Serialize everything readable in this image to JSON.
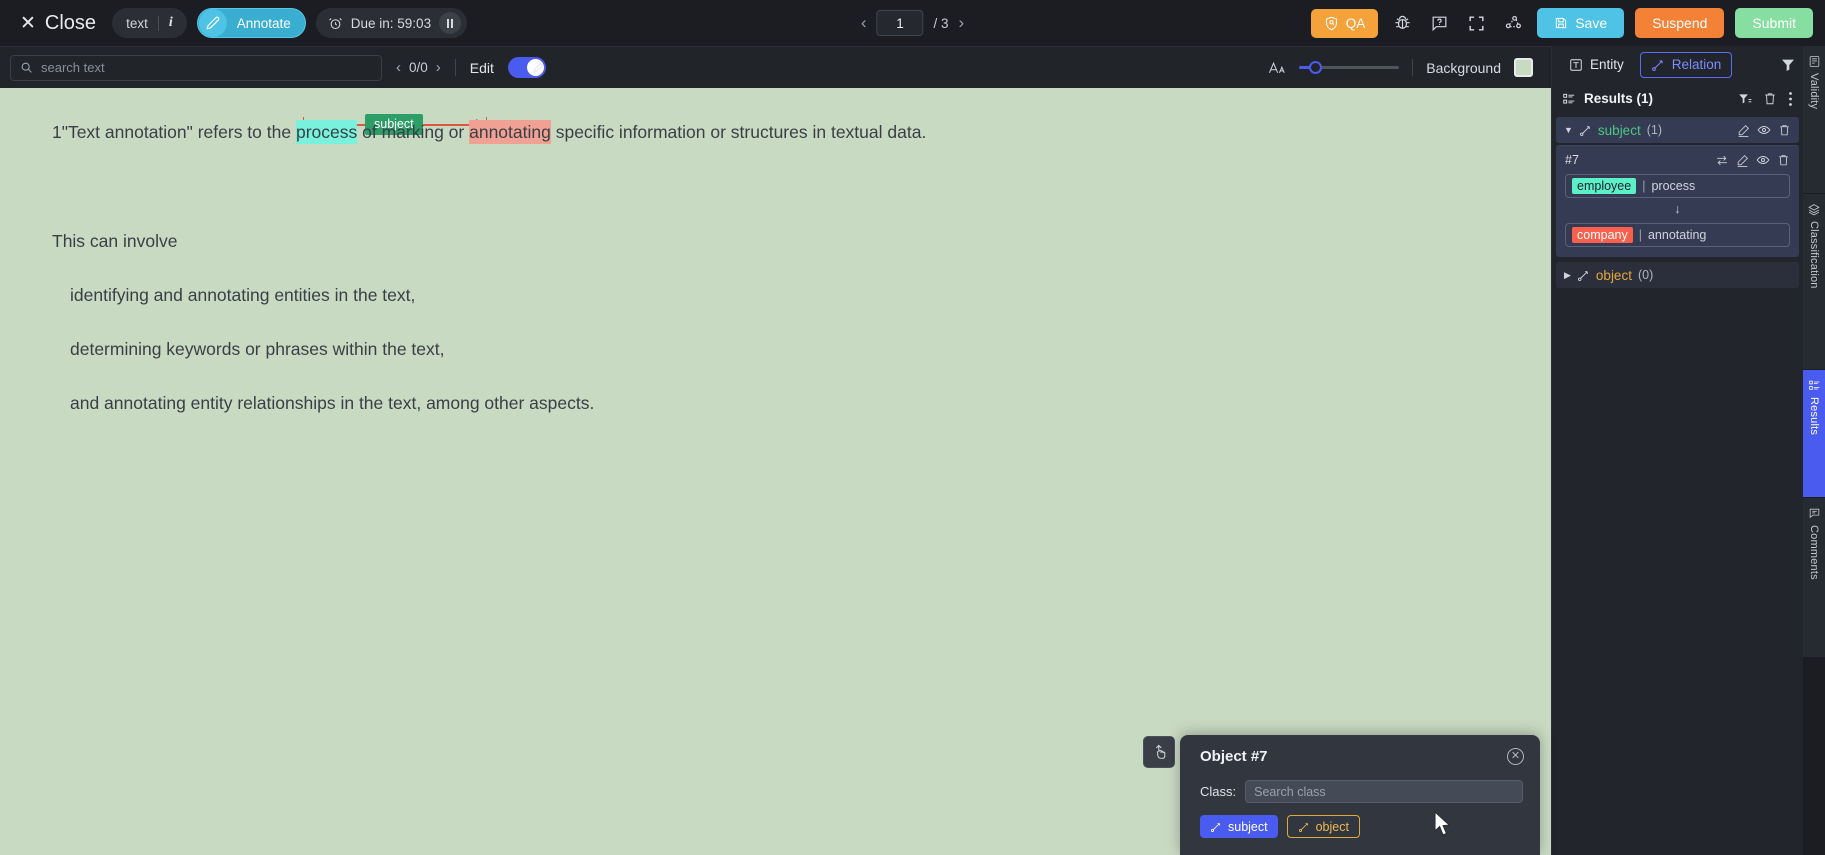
{
  "topbar": {
    "close_label": "Close",
    "doc_type": "text",
    "info_icon": "i",
    "annotate_label": "Annotate",
    "due_label": "Due in: 59:03",
    "page_current": "1",
    "page_total": "/ 3",
    "qa_label": "QA",
    "save_label": "Save",
    "suspend_label": "Suspend",
    "submit_label": "Submit",
    "icons": [
      "bug-icon",
      "help-icon",
      "fullscreen-icon",
      "relation-graph-icon"
    ]
  },
  "toolbar": {
    "search_placeholder": "search text",
    "search_value": "",
    "match_count": "0/0",
    "edit_label": "Edit",
    "edit_enabled": true,
    "font_size_icon": "font-size-icon",
    "background_label": "Background",
    "background_color": "#c9dac3"
  },
  "document": {
    "line1_prefix": "1\"Text annotation\" refers to the ",
    "line1_subject": "process",
    "line1_middle": " of marking or ",
    "line1_object": "annotating",
    "line1_suffix": " specific information or structures in textual data.",
    "relation_label": "subject",
    "line2": "This can involve",
    "line3": "identifying and annotating entities in the text,",
    "line4": "determining keywords or phrases within the text,",
    "line5": "and annotating entity relationships in the text, among other aspects."
  },
  "dialog": {
    "title": "Object #7",
    "class_label": "Class:",
    "class_placeholder": "Search class",
    "class_value": "",
    "chip_subject": "subject",
    "chip_object": "object",
    "close_icon": "✕"
  },
  "panel": {
    "tab_entity": "Entity",
    "tab_relation": "Relation",
    "results_title": "Results (1)",
    "groups": [
      {
        "name": "subject",
        "count": "(1)",
        "expanded": true,
        "color": "#4ec887",
        "items": [
          {
            "id": "#7",
            "source_tag": "employee",
            "source_tag_color": "#5cf0c7",
            "source_text": "process",
            "target_tag": "company",
            "target_tag_color": "#f8604d",
            "target_text": "annotating",
            "separator": "|",
            "arrow": "↓"
          }
        ]
      },
      {
        "name": "object",
        "count": "(0)",
        "expanded": false,
        "color": "#e5a93a",
        "items": []
      }
    ]
  },
  "vtabs": [
    {
      "label": "Validity",
      "icon": "validity-icon",
      "active": false
    },
    {
      "label": "Classification",
      "icon": "classification-icon",
      "active": false
    },
    {
      "label": "Results",
      "icon": "results-icon",
      "active": true
    },
    {
      "label": "Comments",
      "icon": "comments-icon",
      "active": false
    }
  ]
}
